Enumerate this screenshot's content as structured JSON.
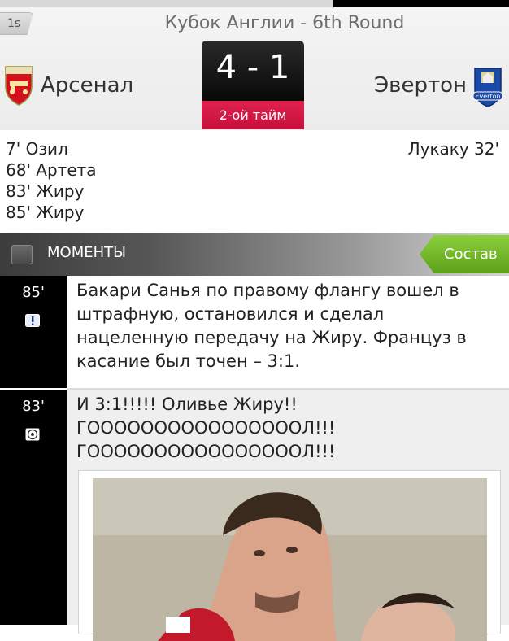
{
  "header": {
    "timer": "1s",
    "competition": "Кубок Англии - 6th Round",
    "home_team": "Арсенал",
    "away_team": "Эвертон",
    "score": "4 - 1",
    "status": "2-ой тайм",
    "away_logo_text": "Everton"
  },
  "goals": {
    "home": [
      "7' Озил",
      "68' Артета",
      "83' Жиру",
      "85' Жиру"
    ],
    "away": [
      "Лукаку 32'"
    ]
  },
  "moments": {
    "title": "МОМЕНТЫ",
    "lineup_button": "Состав"
  },
  "events": [
    {
      "minute": "85'",
      "icon": "exclamation-icon",
      "text": "Бакари Санья по правому флангу вошел в штрафную, остановился и сделал нацеленную передачу на Жиру. Француз в касание был точен – 3:1."
    },
    {
      "minute": "83'",
      "icon": "soccer-ball-icon",
      "text": "И 3:1!!!!! Оливье Жиру!! ГООООООООООООООООЛ!!! ГООООООООООООООООЛ!!!"
    }
  ],
  "colors": {
    "accent_red": "#c8143f",
    "lineup_green": "#6fb32a"
  }
}
